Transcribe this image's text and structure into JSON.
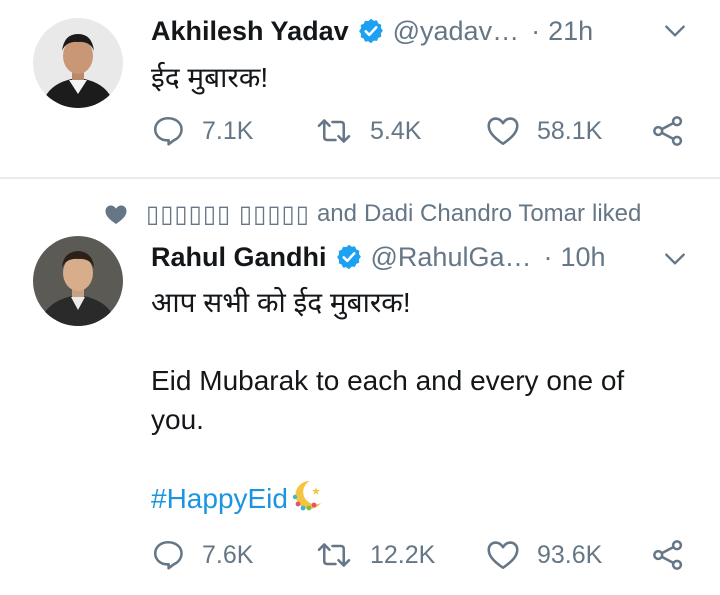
{
  "tweets": [
    {
      "author_name": "Akhilesh Yadav",
      "handle": "@yadav…",
      "separator": "·",
      "time": "21h",
      "text_lines": [
        "ईद मुबारक!"
      ],
      "replies": "7.1K",
      "retweets": "5.4K",
      "likes": "58.1K"
    },
    {
      "social_context": {
        "liker_one": "▯▯▯▯▯▯ ▯▯▯▯▯",
        "conjunction": "and",
        "liker_two": "Dadi Chandro Tomar",
        "action": "liked"
      },
      "author_name": "Rahul Gandhi",
      "handle": "@RahulGa…",
      "separator": "·",
      "time": "10h",
      "text_lines": [
        "आप सभी को ईद मुबारक!",
        "Eid Mubarak to each and every one of you."
      ],
      "hashtag": "#HappyEid",
      "replies": "7.6K",
      "retweets": "12.2K",
      "likes": "93.6K"
    }
  ],
  "colors": {
    "text": "#14171a",
    "secondary": "#657786",
    "link": "#1b95e0",
    "verified": "#1da1f2",
    "divider": "#e6ecf0"
  },
  "icons": [
    "reply-icon",
    "retweet-icon",
    "like-icon",
    "share-icon",
    "verified-badge-icon",
    "chevron-down-icon",
    "heart-icon",
    "eid-moon-emoji"
  ]
}
